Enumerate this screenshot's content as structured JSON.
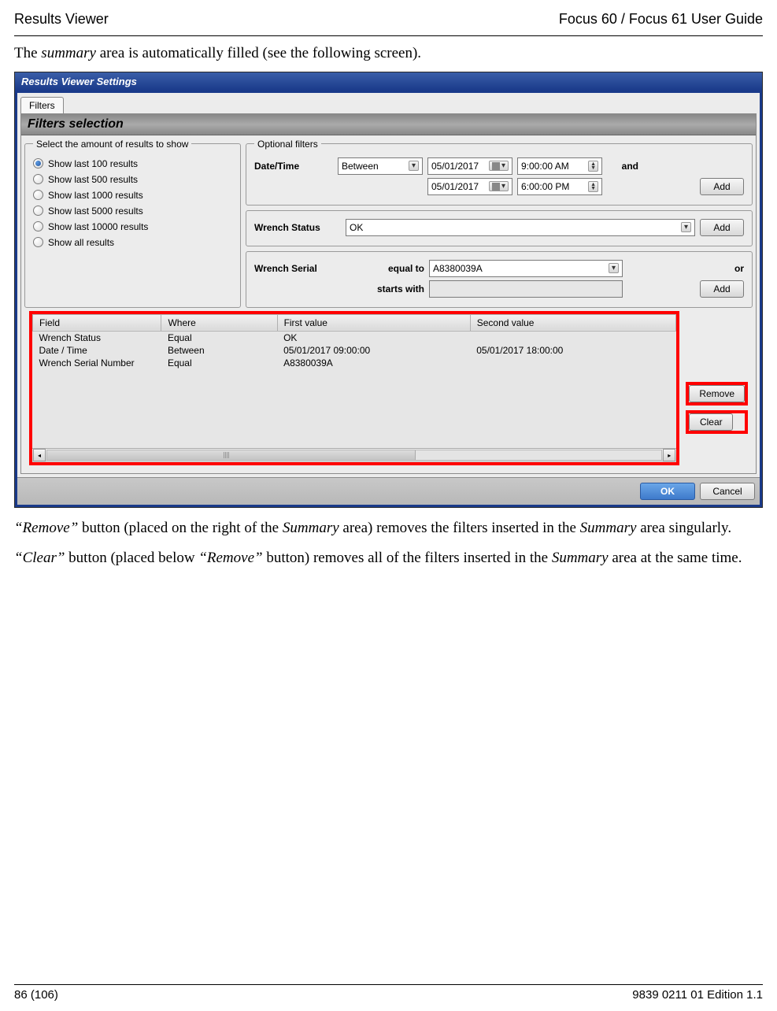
{
  "header": {
    "left": "Results Viewer",
    "right": "Focus 60 / Focus 61 User Guide"
  },
  "intro": {
    "t1": "The ",
    "t2": "summary",
    "t3": " area is automatically filled (see the following screen)."
  },
  "dialog": {
    "title": "Results Viewer Settings",
    "tab": "Filters",
    "banner": "Filters selection",
    "amount_legend": "Select the amount of results to show",
    "amount": [
      "Show last 100 results",
      "Show last 500 results",
      "Show last 1000 results",
      "Show last 5000 results",
      "Show last 10000 results",
      "Show all results"
    ],
    "optional_legend": "Optional filters",
    "dt": {
      "label": "Date/Time",
      "op": "Between",
      "d1": "05/01/2017",
      "t1": "9:00:00 AM",
      "and": "and",
      "d2": "05/01/2017",
      "t2": "6:00:00 PM",
      "add": "Add"
    },
    "ws": {
      "label": "Wrench Status",
      "val": "OK",
      "add": "Add"
    },
    "serial": {
      "label": "Wrench Serial",
      "op": "equal to",
      "val": "A8380039A",
      "or": "or",
      "starts": "starts with",
      "add": "Add"
    },
    "table": {
      "headers": [
        "Field",
        "Where",
        "First value",
        "Second value"
      ],
      "rows": [
        [
          "Wrench Status",
          "Equal",
          "OK",
          ""
        ],
        [
          "Date / Time",
          "Between",
          "05/01/2017 09:00:00",
          "05/01/2017 18:00:00"
        ],
        [
          "Wrench Serial Number",
          "Equal",
          "A8380039A",
          ""
        ]
      ]
    },
    "remove": "Remove",
    "clear": "Clear",
    "ok": "OK",
    "cancel": "Cancel"
  },
  "body": {
    "p1a": "“Remove”",
    "p1b": " button (placed on the right of the ",
    "p1c": "Summary",
    "p1d": " area) removes the filters inserted in the ",
    "p1e": "Summary",
    "p1f": " area singularly.",
    "p2a": "“Clear”",
    "p2b": " button (placed below ",
    "p2c": "“Remove”",
    "p2d": " button) removes all of the filters inserted in the ",
    "p2e": "Summary",
    "p2f": " area at the same time."
  },
  "footer": {
    "left": "86 (106)",
    "right": "9839 0211 01 Edition 1.1"
  }
}
